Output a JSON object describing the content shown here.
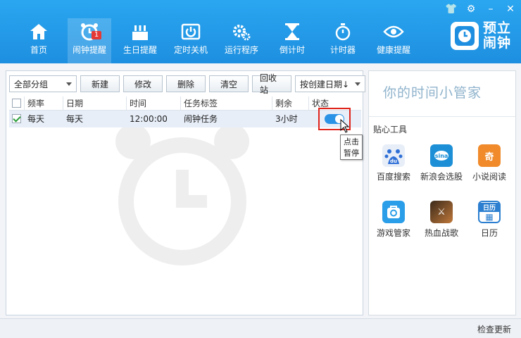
{
  "window_controls": {
    "skin": "👕",
    "settings": "⚙",
    "minimize": "–",
    "close": "✕"
  },
  "nav": [
    {
      "label": "首页",
      "icon": "home-icon"
    },
    {
      "label": "闹钟提醒",
      "icon": "alarm-icon",
      "badge": "1",
      "active": true
    },
    {
      "label": "生日提醒",
      "icon": "cake-icon"
    },
    {
      "label": "定时关机",
      "icon": "power-icon"
    },
    {
      "label": "运行程序",
      "icon": "gears-icon"
    },
    {
      "label": "倒计时",
      "icon": "hourglass-icon"
    },
    {
      "label": "计时器",
      "icon": "stopwatch-icon"
    },
    {
      "label": "健康提醒",
      "icon": "eye-icon"
    }
  ],
  "logo": {
    "text_line1": "预立",
    "text_line2": "闹钟"
  },
  "toolbar": {
    "group_select": "全部分组",
    "new": "新建",
    "edit": "修改",
    "delete": "删除",
    "clear": "清空",
    "recycle": "回收站",
    "sort_select": "按创建日期↓"
  },
  "table": {
    "headers": [
      "频率",
      "日期",
      "时间",
      "任务标签",
      "剩余",
      "状态"
    ],
    "rows": [
      {
        "checked": true,
        "frequency": "每天",
        "date": "每天",
        "time": "12:00:00",
        "label": "闹钟任务",
        "remaining": "3小时",
        "status": "on"
      }
    ]
  },
  "tooltip": "点击暂停",
  "side": {
    "slogan": "你的时间小管家",
    "tools_title": "贴心工具",
    "tools": [
      {
        "label": "百度搜索",
        "icon": "baidu-icon",
        "color": "#2e6fd6",
        "glyph": "du"
      },
      {
        "label": "新浪会选股",
        "icon": "sina-icon",
        "color": "#1c8fd6",
        "glyph": "sina"
      },
      {
        "label": "小说阅读",
        "icon": "novel-icon",
        "color": "#f08a2a",
        "glyph": "奇"
      },
      {
        "label": "游戏管家",
        "icon": "game-manager-icon",
        "color": "#2a9ee8",
        "glyph": "◎"
      },
      {
        "label": "热血战歌",
        "icon": "war-game-icon",
        "color": "#7a4a20",
        "glyph": "⚔"
      },
      {
        "label": "日历",
        "icon": "calendar-icon",
        "color": "#2c7fd0",
        "glyph": "日历"
      }
    ]
  },
  "bottom": {
    "update": "检查更新"
  }
}
